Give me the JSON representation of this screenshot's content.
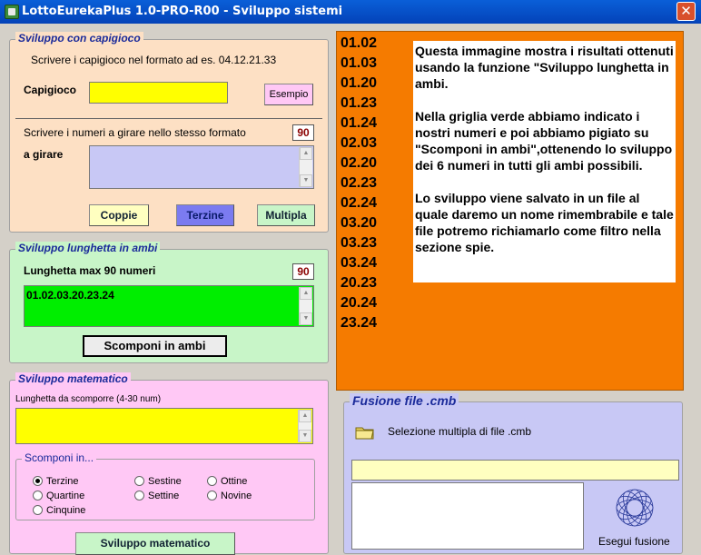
{
  "window": {
    "title": "LottoEurekaPlus 1.0-PRO-R00 - Sviluppo sistemi",
    "close_glyph": "✕"
  },
  "capigioco": {
    "legend": "Sviluppo con capigioco",
    "hint": "Scrivere i capigioco nel formato ad es. 04.12.21.33",
    "field_label": "Capigioco",
    "field_value": "",
    "example_button": "Esempio",
    "numbers_hint": "Scrivere i numeri a girare nello stesso formato",
    "numbers_counter": "90",
    "rotate_label": "a girare",
    "rotate_value": "",
    "buttons": {
      "coppie": "Coppie",
      "terzine": "Terzine",
      "multipla": "Multipla"
    }
  },
  "lunghetta": {
    "legend": "Sviluppo lunghetta in ambi",
    "max_label": "Lunghetta max 90 numeri",
    "counter": "90",
    "value": "01.02.03.20.23.24",
    "button": "Scomponi in ambi"
  },
  "matematico": {
    "legend": "Sviluppo matematico",
    "length_label": "Lunghetta da scomporre (4-30 num)",
    "value": "",
    "group_legend": "Scomponi in...",
    "options": [
      "Terzine",
      "Sestine",
      "Ottine",
      "Quartine",
      "Settine",
      "Novine",
      "Cinquine"
    ],
    "selected": "Terzine",
    "button": "Sviluppo matematico"
  },
  "results": [
    "01.02",
    "01.03",
    "01.20",
    "01.23",
    "01.24",
    "02.03",
    "02.20",
    "02.23",
    "02.24",
    "03.20",
    "03.23",
    "03.24",
    "20.23",
    "20.24",
    "23.24"
  ],
  "note": {
    "p1": "Questa immagine mostra i risultati ottenuti usando la funzione \"Sviluppo lunghetta in ambi.",
    "p2": "Nella griglia verde abbiamo indicato i nostri numeri e poi abbiamo pigiato su \"Scomponi in ambi\",ottenendo lo sviluppo dei 6 numeri in tutti gli ambi possibili.",
    "p3": "Lo sviluppo viene salvato in un file al quale daremo un nome rimembrabile e tale file potremo richiamarlo come filtro nella sezione spie."
  },
  "fusione": {
    "legend": "Fusione file .cmb",
    "multi_select": "Selezione multipla di file .cmb",
    "path_value": "",
    "execute": "Esegui fusione"
  },
  "colors": {
    "peach": "#fde0c4",
    "green_panel": "#c8f5c8",
    "green_input": "#00ee00",
    "pink": "#ffc8f5",
    "yellow_input": "#ffff00",
    "lavender_input": "#c8c8f5",
    "orange": "#f57b00",
    "fusione_bg": "#c8c8f5",
    "legend_blue": "#1a2a9a",
    "counter_red": "#8a0000"
  },
  "icons": [
    "app-icon",
    "close-icon",
    "folder-icon",
    "spirograph-icon"
  ]
}
